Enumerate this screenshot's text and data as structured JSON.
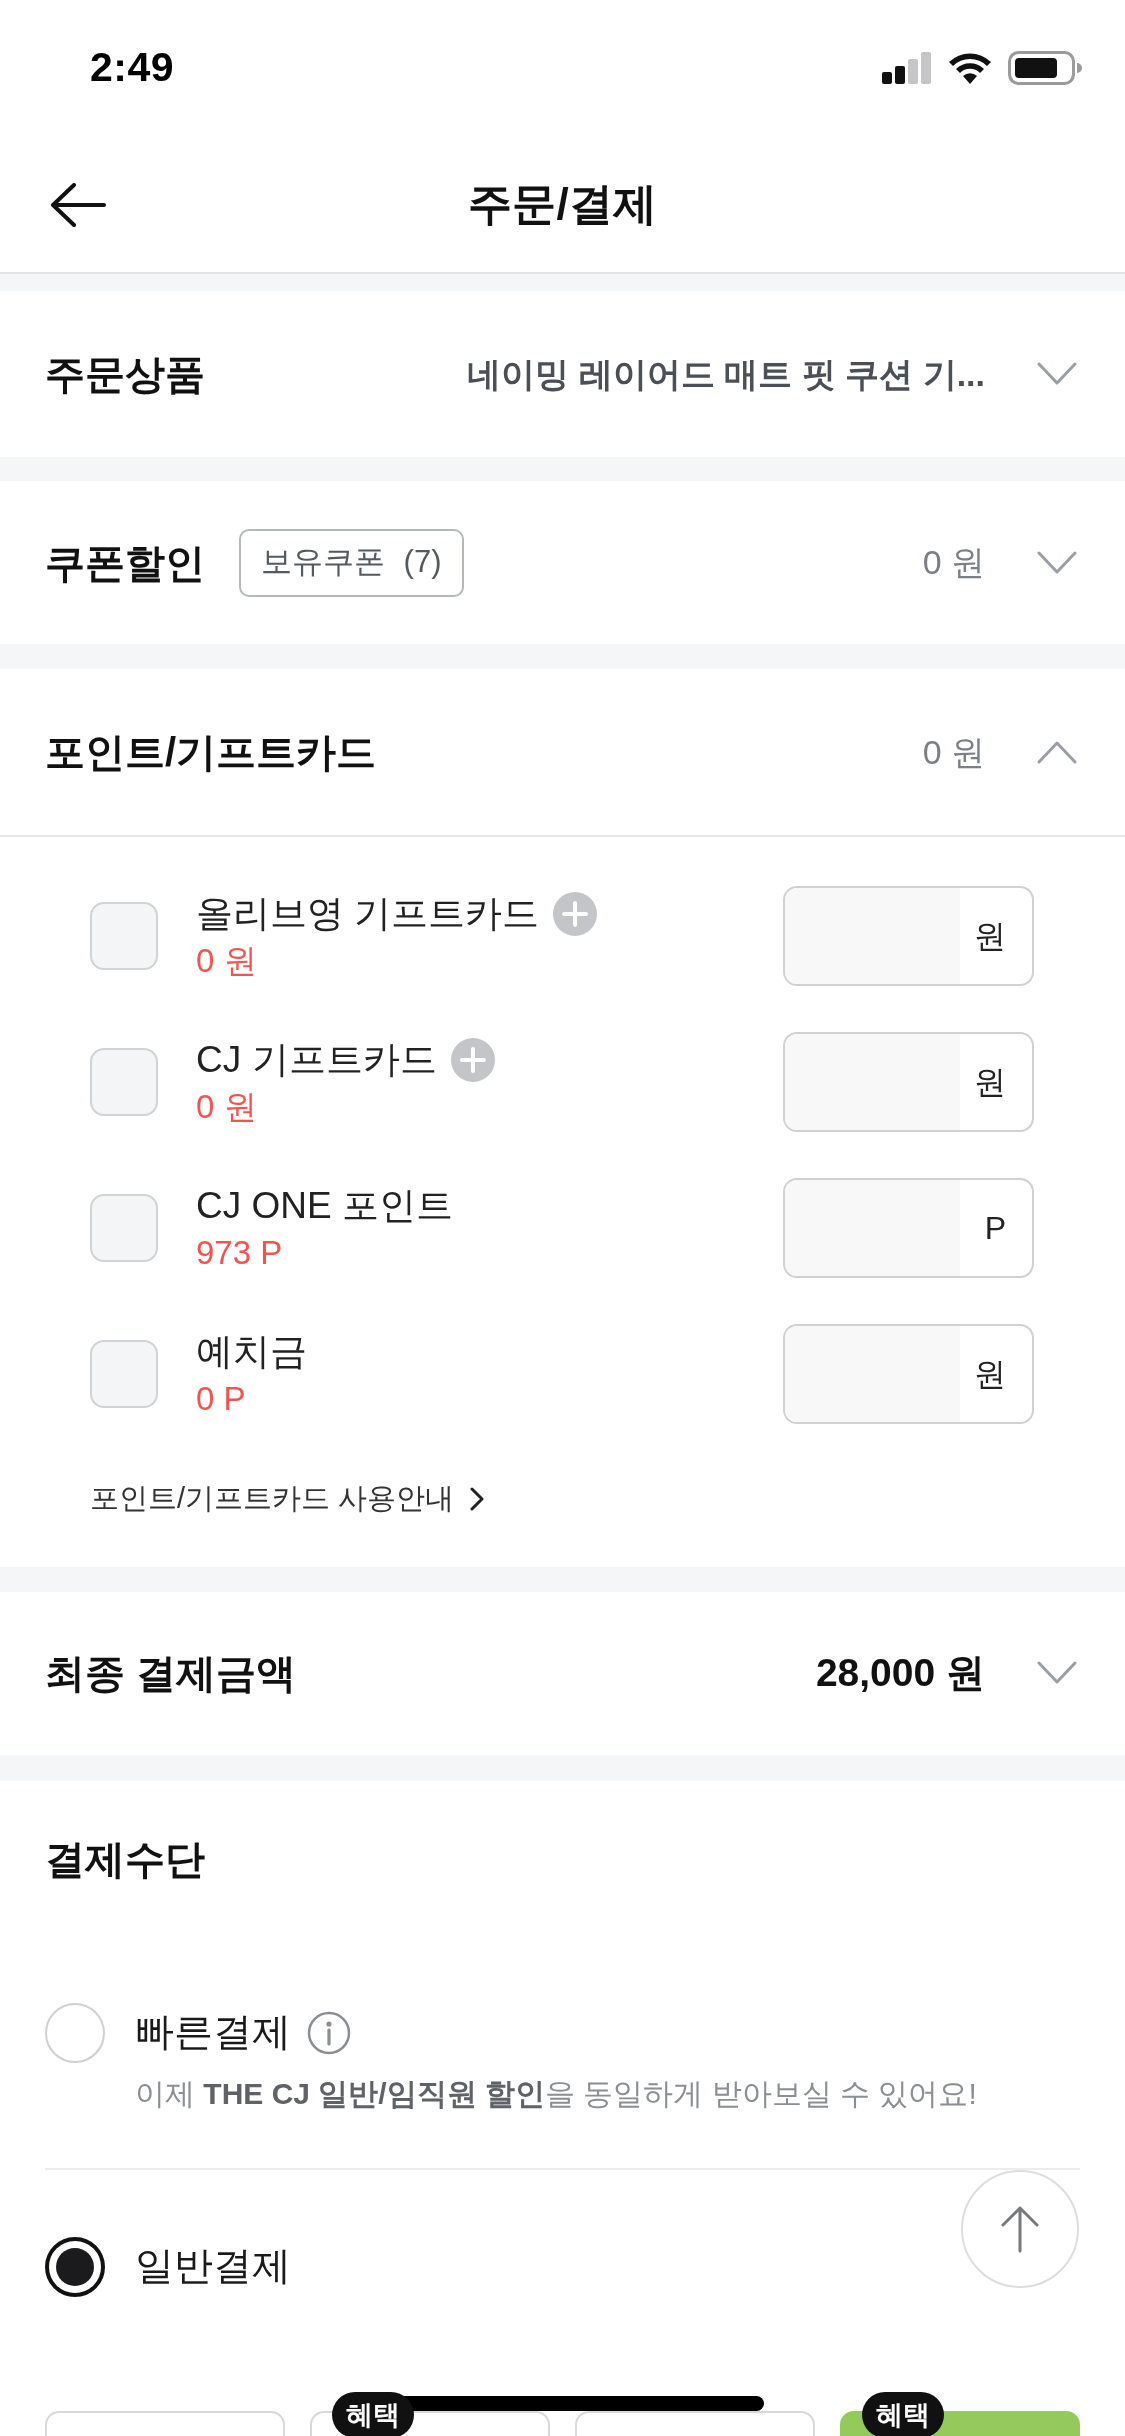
{
  "status_bar": {
    "time": "2:49"
  },
  "header": {
    "title": "주문/결제"
  },
  "order_items": {
    "title": "주문상품",
    "summary": "네이밍 레이어드 매트 핏 쿠션 기...",
    "expanded": false
  },
  "coupon": {
    "title": "쿠폰할인",
    "owned_coupons": "보유쿠폰 (7)",
    "amount": "0 원",
    "expanded": false
  },
  "points": {
    "title": "포인트/기프트카드",
    "amount": "0 원",
    "expanded": true,
    "items": [
      {
        "name": "올리브영 기프트카드",
        "addable": true,
        "balance": "0 원",
        "unit": "원",
        "checked": false
      },
      {
        "name": "CJ 기프트카드",
        "addable": true,
        "balance": "0 원",
        "unit": "원",
        "checked": false
      },
      {
        "name": "CJ ONE 포인트",
        "addable": false,
        "balance": "973 P",
        "unit": "P",
        "checked": false
      },
      {
        "name": "예치금",
        "addable": false,
        "balance": "0 P",
        "unit": "원",
        "checked": false
      }
    ],
    "guide_link": "포인트/기프트카드 사용안내"
  },
  "final_payment": {
    "title": "최종 결제금액",
    "amount": "28,000 원",
    "expanded": false
  },
  "payment_method": {
    "title": "결제수단",
    "options": [
      {
        "label": "빠른결제",
        "info": true,
        "description": "이제 **THE CJ 일반/임직원 할인**을 동일하게 받아보실 수 있어요!",
        "selected": false
      },
      {
        "label": "일반결제",
        "info": false,
        "selected": true
      }
    ],
    "methods": [
      {
        "selected": false
      },
      {
        "badge": "혜택",
        "selected": false
      },
      {
        "selected": false
      },
      {
        "badge": "혜택",
        "selected": true
      }
    ]
  }
}
